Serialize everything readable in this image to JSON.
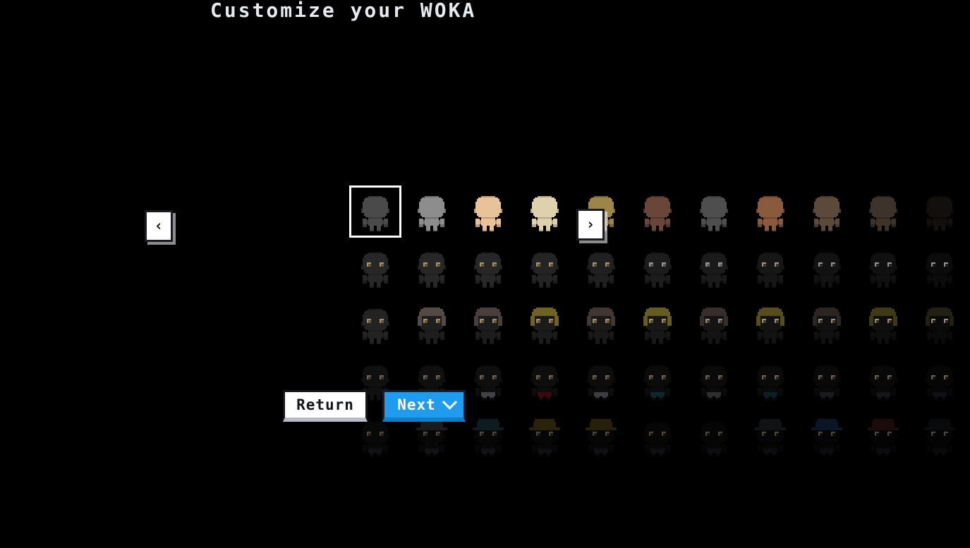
{
  "page": {
    "title": "Customize your WOKA",
    "background_color": "#000000",
    "title_color": "#e8eaed"
  },
  "navigation": {
    "prev_label": "‹",
    "prev_icon": "chevron-left-icon",
    "next_label": "›",
    "next_icon": "chevron-right-icon"
  },
  "actions": {
    "return_label": "Return",
    "return_bg": "#ffffff",
    "return_fg": "#13151a",
    "next_label": "Next",
    "next_bg": "#209cee",
    "next_fg": "#ffffff",
    "next_caret_icon": "chevron-down-icon"
  },
  "grid": {
    "columns": 11,
    "rows": 5,
    "cell_size": 68,
    "col_step": 80,
    "row_step": 80,
    "selected_row": 0,
    "selected_col": 0,
    "selection_color": "#ffffff",
    "layers": [
      {
        "name": "body",
        "row": 0,
        "dim": 1.0,
        "items": [
          {
            "label": "body-1",
            "skin": "#4a4a4a",
            "skin_shadow": "#3a3a3a",
            "hair": null,
            "eyes": false,
            "clothes": null,
            "hat": null
          },
          {
            "label": "body-2",
            "skin": "#8d8d8d",
            "skin_shadow": "#6f6f6f",
            "hair": null,
            "eyes": false,
            "clothes": null,
            "hat": null
          },
          {
            "label": "body-3",
            "skin": "#e8c39a",
            "skin_shadow": "#c49a6f",
            "hair": null,
            "eyes": false,
            "clothes": null,
            "hat": null
          },
          {
            "label": "body-4",
            "skin": "#ded1ab",
            "skin_shadow": "#b8a883",
            "hair": null,
            "eyes": false,
            "clothes": null,
            "hat": null
          },
          {
            "label": "body-5",
            "skin": "#9d8545",
            "skin_shadow": "#7a6634",
            "hair": null,
            "eyes": false,
            "clothes": null,
            "hat": null
          },
          {
            "label": "body-6",
            "skin": "#6a4638",
            "skin_shadow": "#52362a",
            "hair": null,
            "eyes": false,
            "clothes": null,
            "hat": null
          },
          {
            "label": "body-7",
            "skin": "#4e4e4e",
            "skin_shadow": "#3c3c3c",
            "hair": null,
            "eyes": false,
            "clothes": null,
            "hat": null
          },
          {
            "label": "body-8",
            "skin": "#8a5a3c",
            "skin_shadow": "#6b452e",
            "hair": null,
            "eyes": false,
            "clothes": null,
            "hat": null
          },
          {
            "label": "body-9",
            "skin": "#5b4a3a",
            "skin_shadow": "#46392c",
            "hair": null,
            "eyes": false,
            "clothes": null,
            "hat": null
          },
          {
            "label": "body-10",
            "skin": "#3e332a",
            "skin_shadow": "#2e261f",
            "hair": null,
            "eyes": false,
            "clothes": null,
            "hat": null
          },
          {
            "label": "body-11",
            "skin": "#120f0c",
            "skin_shadow": "#0c0a08",
            "hair": null,
            "eyes": false,
            "clothes": null,
            "hat": null
          }
        ]
      },
      {
        "name": "eyes",
        "row": 1,
        "dim": 0.62,
        "items": [
          {
            "label": "eyes-1",
            "skin": "#3f3f3f",
            "skin_shadow": "#333333",
            "hair": null,
            "eyes": true,
            "eye_color": "#c98a2e",
            "clothes": null,
            "hat": null
          },
          {
            "label": "eyes-2",
            "skin": "#3f3f3f",
            "skin_shadow": "#333333",
            "hair": null,
            "eyes": true,
            "eye_color": "#c98a2e",
            "clothes": null,
            "hat": null
          },
          {
            "label": "eyes-3",
            "skin": "#3f3f3f",
            "skin_shadow": "#333333",
            "hair": null,
            "eyes": true,
            "eye_color": "#c98a2e",
            "clothes": null,
            "hat": null
          },
          {
            "label": "eyes-4",
            "skin": "#3a3a3a",
            "skin_shadow": "#2f2f2f",
            "hair": null,
            "eyes": true,
            "eye_color": "#c98a2e",
            "clothes": null,
            "hat": null
          },
          {
            "label": "eyes-5",
            "skin": "#343434",
            "skin_shadow": "#2a2a2a",
            "hair": null,
            "eyes": true,
            "eye_color": "#b07a28",
            "clothes": null,
            "hat": null
          },
          {
            "label": "eyes-6",
            "skin": "#2e2e2e",
            "skin_shadow": "#252525",
            "hair": null,
            "eyes": true,
            "eye_color": "#8d9099",
            "clothes": null,
            "hat": null
          },
          {
            "label": "eyes-7",
            "skin": "#2a2a2a",
            "skin_shadow": "#222222",
            "hair": null,
            "eyes": true,
            "eye_color": "#a0a4ad",
            "clothes": null,
            "hat": null
          },
          {
            "label": "eyes-8",
            "skin": "#242424",
            "skin_shadow": "#1d1d1d",
            "hair": null,
            "eyes": true,
            "eye_color": "#6e5a33",
            "clothes": null,
            "hat": null
          },
          {
            "label": "eyes-9",
            "skin": "#1e1e1e",
            "skin_shadow": "#181818",
            "hair": null,
            "eyes": true,
            "eye_color": "#4a4a4a",
            "clothes": null,
            "hat": null
          },
          {
            "label": "eyes-10",
            "skin": "#1a1a1a",
            "skin_shadow": "#141414",
            "hair": null,
            "eyes": true,
            "eye_color": "#3e3e3e",
            "clothes": null,
            "hat": null
          },
          {
            "label": "eyes-11",
            "skin": "#121212",
            "skin_shadow": "#0e0e0e",
            "hair": null,
            "eyes": true,
            "eye_color": "#2e2e2e",
            "clothes": null,
            "hat": null
          }
        ]
      },
      {
        "name": "hair",
        "row": 2,
        "dim": 0.6,
        "items": [
          {
            "label": "hair-none",
            "skin": "#3b3b3b",
            "skin_shadow": "#2f2f2f",
            "hair": null,
            "eyes": true,
            "eye_color": "#c98a2e",
            "clothes": null,
            "hat": null
          },
          {
            "label": "hair-2",
            "skin": "#333333",
            "skin_shadow": "#2a2a2a",
            "hair": "#8e7a74",
            "eyes": true,
            "eye_color": "#c98a2e",
            "clothes": null,
            "hat": null
          },
          {
            "label": "hair-3",
            "skin": "#303030",
            "skin_shadow": "#272727",
            "hair": "#7e6a64",
            "eyes": true,
            "eye_color": "#c98a2e",
            "clothes": null,
            "hat": null
          },
          {
            "label": "hair-4",
            "skin": "#2e2e2e",
            "skin_shadow": "#252525",
            "hair": "#b9a33a",
            "eyes": true,
            "eye_color": "#c98a2e",
            "clothes": null,
            "hat": null
          },
          {
            "label": "hair-5",
            "skin": "#2a2a2a",
            "skin_shadow": "#222222",
            "hair": "#6e5a54",
            "eyes": true,
            "eye_color": "#c98a2e",
            "clothes": null,
            "hat": null
          },
          {
            "label": "hair-6",
            "skin": "#272727",
            "skin_shadow": "#1f1f1f",
            "hair": "#a99a38",
            "eyes": true,
            "eye_color": "#b07a28",
            "clothes": null,
            "hat": null
          },
          {
            "label": "hair-7",
            "skin": "#222222",
            "skin_shadow": "#1b1b1b",
            "hair": "#5c4c46",
            "eyes": true,
            "eye_color": "#8a6a30",
            "clothes": null,
            "hat": null
          },
          {
            "label": "hair-8",
            "skin": "#1e1e1e",
            "skin_shadow": "#181818",
            "hair": "#8e8030",
            "eyes": true,
            "eye_color": "#7a5c2a",
            "clothes": null,
            "hat": null
          },
          {
            "label": "hair-9",
            "skin": "#1b1b1b",
            "skin_shadow": "#151515",
            "hair": "#4a3e38",
            "eyes": true,
            "eye_color": "#6a5026",
            "clothes": null,
            "hat": null
          },
          {
            "label": "hair-10",
            "skin": "#181818",
            "skin_shadow": "#131313",
            "hair": "#6a6024",
            "eyes": true,
            "eye_color": "#5c461f",
            "clothes": null,
            "hat": null
          },
          {
            "label": "hair-11",
            "skin": "#121212",
            "skin_shadow": "#0e0e0e",
            "hair": "#3a3420",
            "eyes": true,
            "eye_color": "#42321a",
            "clothes": null,
            "hat": null
          }
        ]
      },
      {
        "name": "clothes",
        "row": 3,
        "dim": 0.42,
        "items": [
          {
            "label": "clothes-1",
            "skin": "#262626",
            "skin_shadow": "#1e1e1e",
            "hair": null,
            "eyes": true,
            "eye_color": "#b07a28",
            "clothes": null,
            "hat": null
          },
          {
            "label": "clothes-2",
            "skin": "#242424",
            "skin_shadow": "#1d1d1d",
            "hair": null,
            "eyes": true,
            "eye_color": "#b07a28",
            "clothes": null,
            "hat": null
          },
          {
            "label": "clothes-3",
            "skin": "#222222",
            "skin_shadow": "#1b1b1b",
            "hair": null,
            "eyes": true,
            "eye_color": "#b07a28",
            "clothes": "#9aa0a8",
            "hat": null
          },
          {
            "label": "clothes-4",
            "skin": "#202020",
            "skin_shadow": "#191919",
            "hair": null,
            "eyes": true,
            "eye_color": "#a87427",
            "clothes": "#8e1420",
            "hat": null
          },
          {
            "label": "clothes-5",
            "skin": "#1e1e1e",
            "skin_shadow": "#181818",
            "hair": null,
            "eyes": true,
            "eye_color": "#a87427",
            "clothes": "#8a8f96",
            "hat": null
          },
          {
            "label": "clothes-6",
            "skin": "#1c1c1c",
            "skin_shadow": "#161616",
            "hair": null,
            "eyes": true,
            "eye_color": "#9a6a24",
            "clothes": "#1f5c66",
            "hat": null
          },
          {
            "label": "clothes-7",
            "skin": "#1a1a1a",
            "skin_shadow": "#141414",
            "hair": null,
            "eyes": true,
            "eye_color": "#8e6222",
            "clothes": "#6a6e74",
            "hat": null
          },
          {
            "label": "clothes-8",
            "skin": "#181818",
            "skin_shadow": "#131313",
            "hair": null,
            "eyes": true,
            "eye_color": "#7e571e",
            "clothes": "#1a4a52",
            "hat": null
          },
          {
            "label": "clothes-9",
            "skin": "#161616",
            "skin_shadow": "#111111",
            "hair": null,
            "eyes": true,
            "eye_color": "#6e4c1a",
            "clothes": "#3a3e44",
            "hat": null
          },
          {
            "label": "clothes-10",
            "skin": "#141414",
            "skin_shadow": "#0f0f0f",
            "hair": null,
            "eyes": true,
            "eye_color": "#5e4116",
            "clothes": "#2e3238",
            "hat": null
          },
          {
            "label": "clothes-11",
            "skin": "#101010",
            "skin_shadow": "#0c0c0c",
            "hair": null,
            "eyes": true,
            "eye_color": "#463112",
            "clothes": "#242830",
            "hat": null
          }
        ]
      },
      {
        "name": "hats",
        "row": 4,
        "dim": 0.3,
        "items": [
          {
            "label": "hat-none",
            "skin": "#1c1c1c",
            "skin_shadow": "#161616",
            "hair": null,
            "eyes": true,
            "eye_color": "#8a6020",
            "clothes": "#3a3e44",
            "hat": null
          },
          {
            "label": "hat-2",
            "skin": "#1a1a1a",
            "skin_shadow": "#141414",
            "hair": null,
            "eyes": true,
            "eye_color": "#8a6020",
            "clothes": "#3a3e44",
            "hat": "#55595f"
          },
          {
            "label": "hat-3",
            "skin": "#181818",
            "skin_shadow": "#131313",
            "hair": null,
            "eyes": true,
            "eye_color": "#7e571e",
            "clothes": "#3a3e44",
            "hat": "#2b5f6b"
          },
          {
            "label": "hat-4",
            "skin": "#161616",
            "skin_shadow": "#111111",
            "hair": null,
            "eyes": true,
            "eye_color": "#6e4c1a",
            "clothes": "#32363c",
            "hat": "#8a7620"
          },
          {
            "label": "hat-5",
            "skin": "#151515",
            "skin_shadow": "#101010",
            "hair": null,
            "eyes": true,
            "eye_color": "#6a4a19",
            "clothes": "#32363c",
            "hat": "#7e6c1e"
          },
          {
            "label": "hat-6",
            "skin": "#141414",
            "skin_shadow": "#0f0f0f",
            "hair": null,
            "eyes": true,
            "eye_color": "#5e4116",
            "clothes": "#2e3238",
            "hat": null
          },
          {
            "label": "hat-7",
            "skin": "#131313",
            "skin_shadow": "#0e0e0e",
            "hair": null,
            "eyes": true,
            "eye_color": "#563b14",
            "clothes": "#2a2e34",
            "hat": null
          },
          {
            "label": "hat-8",
            "skin": "#121212",
            "skin_shadow": "#0d0d0d",
            "hair": null,
            "eyes": true,
            "eye_color": "#4e3512",
            "clothes": "#282c32",
            "hat": "#3a3e44"
          },
          {
            "label": "hat-9",
            "skin": "#111111",
            "skin_shadow": "#0c0c0c",
            "hair": null,
            "eyes": true,
            "eye_color": "#46300f",
            "clothes": "#262a30",
            "hat": "#1e4a7a"
          },
          {
            "label": "hat-10",
            "skin": "#101010",
            "skin_shadow": "#0b0b0b",
            "hair": null,
            "eyes": true,
            "eye_color": "#3e2a0e",
            "clothes": "#24282e",
            "hat": "#5a2a1e"
          },
          {
            "label": "hat-11",
            "skin": "#0e0e0e",
            "skin_shadow": "#0a0a0a",
            "hair": null,
            "eyes": true,
            "eye_color": "#32220b",
            "clothes": "#202429",
            "hat": "#20242a"
          }
        ]
      }
    ]
  }
}
